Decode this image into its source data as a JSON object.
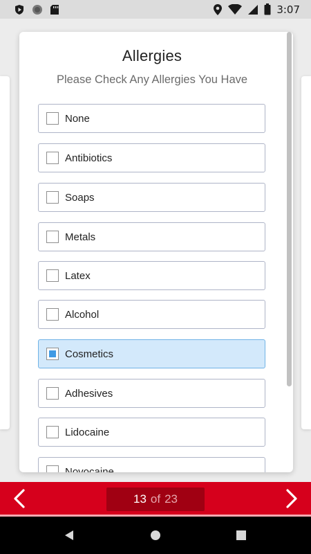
{
  "status_bar": {
    "time": "3:07",
    "icons": [
      "shield-play-icon",
      "circle-icon",
      "sd-card-icon",
      "location-icon",
      "wifi-icon",
      "signal-icon",
      "battery-icon"
    ]
  },
  "card": {
    "title": "Allergies",
    "subtitle": "Please Check Any Allergies You Have",
    "options": [
      {
        "label": "None",
        "checked": false
      },
      {
        "label": "Antibiotics",
        "checked": false
      },
      {
        "label": "Soaps",
        "checked": false
      },
      {
        "label": "Metals",
        "checked": false
      },
      {
        "label": "Latex",
        "checked": false
      },
      {
        "label": "Alcohol",
        "checked": false
      },
      {
        "label": "Cosmetics",
        "checked": true
      },
      {
        "label": "Adhesives",
        "checked": false
      },
      {
        "label": "Lidocaine",
        "checked": false
      },
      {
        "label": "Novocaine",
        "checked": false
      }
    ]
  },
  "pager": {
    "current": "13",
    "separator": "of",
    "total": "23",
    "prev_icon": "chevron-left-icon",
    "next_icon": "chevron-right-icon"
  },
  "colors": {
    "brand_red": "#d6001c",
    "pager_pill": "#a00012",
    "checked_bg": "#d3e9fb",
    "checkbox_fill": "#3f9ae4"
  },
  "android_nav": [
    "back-icon",
    "home-icon",
    "recents-icon"
  ]
}
